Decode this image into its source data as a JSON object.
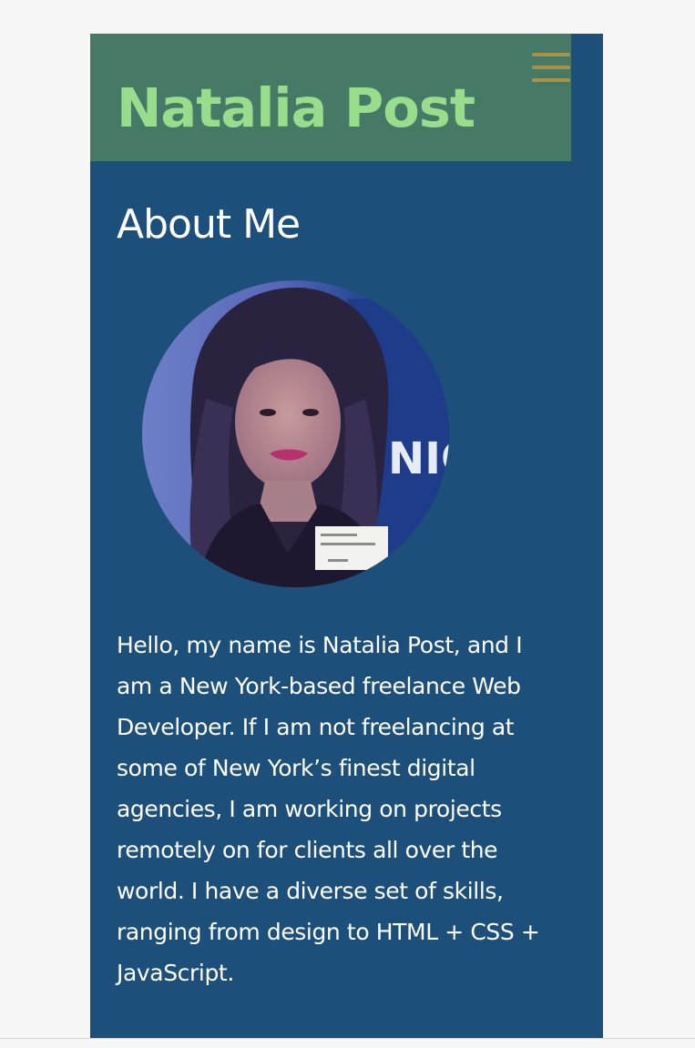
{
  "header": {
    "site_title": "Natalia Post",
    "menu_icon": "hamburger-menu-icon"
  },
  "about": {
    "heading": "About Me",
    "photo_badge_text": "NIC",
    "bio_text": "Hello, my name is Natalia Post, and I am a New York-based freelance Web Developer. If I am not freelancing at some of New York’s finest digital agencies, I am working on projects remotely on for clients all over the world. I have a diverse set of skills, ranging from design to HTML + CSS + JavaScript."
  },
  "colors": {
    "page_background": "#f7f7f8",
    "content_background": "#1c4f79",
    "header_background": "#477a66",
    "title_color": "#97dd8c",
    "menu_icon_color": "#a99148",
    "text_color": "#ffffff"
  }
}
